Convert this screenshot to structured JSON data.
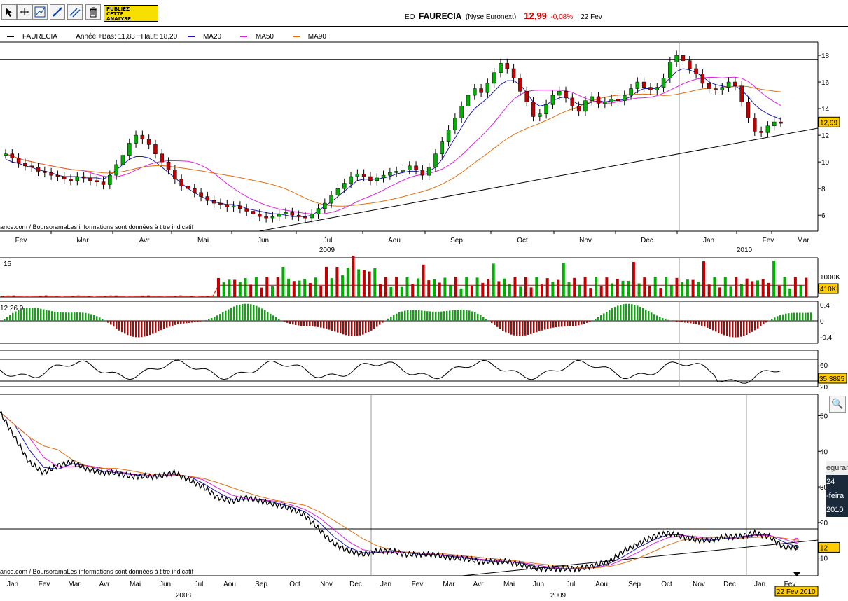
{
  "toolbar": {
    "ad_line1": "PUBLIEZ",
    "ad_line2": "CETTE",
    "ad_line3": "ANALYSE",
    "icons": [
      "cursor-icon",
      "crosshair-icon",
      "indicator-icon",
      "trendline-icon",
      "channel-icon",
      "trash-icon"
    ]
  },
  "header": {
    "code": "EO",
    "name": "FAURECIA",
    "market": "(Nyse Euronext)",
    "price": "12,99",
    "change": "-0,08%",
    "date": "22 Fev"
  },
  "legend": {
    "series": "FAURECIA",
    "range": "Année +Bas: 11,83 +Haut: 18,20",
    "ma20": "MA20",
    "ma50": "MA50",
    "ma90": "MA90"
  },
  "colors": {
    "up": "#00b000",
    "down": "#c00000",
    "ma20": "#1a1ab0",
    "ma50": "#e020e0",
    "ma90": "#e07010"
  },
  "copyright": "ance.com / BoursoramaLes informations sont données à titre indicatif",
  "chart_data": [
    {
      "type": "candlestick",
      "panel": "price-1y",
      "xlabels": [
        "Fev",
        "Mar",
        "Avr",
        "Mai",
        "Jun",
        "Jul",
        "Aou",
        "Sep",
        "Oct",
        "Nov",
        "Dec",
        "Jan",
        "Fev",
        "Mar"
      ],
      "years": [
        "2009",
        "2010"
      ],
      "yticks": [
        "18",
        "16",
        "14",
        "12",
        "10",
        "8",
        "6"
      ],
      "ylim": [
        4.8,
        19
      ],
      "price_label": "12,99",
      "close": [
        10.6,
        10.3,
        9.9,
        9.7,
        9.6,
        9.3,
        9.2,
        9.0,
        8.9,
        8.7,
        8.6,
        8.9,
        8.8,
        8.6,
        8.5,
        8.3,
        9.0,
        9.8,
        10.5,
        11.4,
        12.0,
        11.7,
        11.3,
        10.6,
        10.0,
        9.4,
        8.7,
        8.2,
        8.0,
        7.7,
        7.4,
        7.1,
        6.9,
        6.8,
        6.6,
        6.7,
        6.5,
        6.3,
        6.1,
        5.9,
        5.8,
        5.9,
        6.1,
        6.2,
        6.0,
        5.9,
        5.8,
        6.1,
        6.5,
        6.9,
        7.5,
        8.0,
        8.4,
        8.9,
        9.1,
        8.9,
        8.6,
        8.8,
        9.0,
        9.2,
        9.3,
        9.4,
        9.7,
        9.4,
        9.0,
        9.6,
        10.6,
        11.5,
        12.4,
        13.3,
        14.2,
        15.0,
        15.5,
        15.2,
        15.9,
        16.7,
        17.4,
        17.0,
        16.3,
        15.3,
        14.5,
        13.4,
        13.6,
        14.3,
        15.0,
        15.3,
        14.8,
        14.2,
        13.8,
        14.6,
        14.9,
        14.4,
        14.5,
        14.7,
        14.6,
        15.0,
        15.5,
        16.0,
        15.6,
        15.4,
        15.6,
        16.3,
        17.5,
        18.0,
        17.6,
        17.0,
        16.6,
        15.9,
        15.5,
        15.4,
        15.6,
        16.0,
        15.7,
        14.5,
        13.3,
        12.3,
        12.2,
        12.7,
        13.0,
        12.99
      ],
      "ma20": [
        10.2,
        10.0,
        9.9,
        9.7,
        9.6,
        9.4,
        9.3,
        9.2,
        9.0,
        8.9,
        8.9,
        8.9,
        8.8,
        8.8,
        8.8,
        8.7,
        9.0,
        9.4,
        9.8,
        10.2,
        10.4,
        10.4,
        10.3,
        10.0,
        9.6,
        9.2,
        8.8,
        8.4,
        8.0,
        7.7,
        7.4,
        7.2,
        7.0,
        6.9,
        6.8,
        6.8,
        6.7,
        6.5,
        6.4,
        6.3,
        6.2,
        6.1,
        6.1,
        6.0,
        5.9,
        5.9,
        5.9,
        6.0,
        6.3,
        6.7,
        7.0,
        7.4,
        7.8,
        8.2,
        8.6,
        8.7,
        8.7,
        8.7,
        8.8,
        8.9,
        9.1,
        9.2,
        9.3,
        9.3,
        9.2,
        9.3,
        9.6,
        10.2,
        11.0,
        11.8,
        12.6,
        13.4,
        14.0,
        14.4,
        14.8,
        15.3,
        15.8,
        16.1,
        16.1,
        15.8,
        15.2,
        14.5,
        14.2,
        14.3,
        14.6,
        14.8,
        14.9,
        14.6,
        14.3,
        14.3,
        14.5,
        14.6,
        14.5,
        14.6,
        14.6,
        14.7,
        14.9,
        15.3,
        15.5,
        15.5,
        15.5,
        15.8,
        16.3,
        16.8,
        17.0,
        16.9,
        16.7,
        16.4,
        16.0,
        15.8,
        15.7,
        15.6,
        15.7,
        15.4,
        14.9,
        14.3,
        13.9,
        13.6,
        13.4,
        13.2
      ]
    },
    {
      "type": "bar",
      "panel": "volume",
      "label": "15",
      "yticks": [
        "1000K"
      ],
      "value_label": "410K"
    },
    {
      "type": "bar",
      "panel": "macd",
      "label": "12 26 9",
      "yticks": [
        "0,4",
        "0",
        "-0,4"
      ]
    },
    {
      "type": "line",
      "panel": "rsi",
      "yticks": [
        "60",
        "20"
      ],
      "value_label": "35,3895"
    },
    {
      "type": "line",
      "panel": "price-3y",
      "xlabels": [
        "Jan",
        "Fev",
        "Mar",
        "Avr",
        "Mai",
        "Jun",
        "Jul",
        "Aou",
        "Sep",
        "Oct",
        "Nov",
        "Dec",
        "Jan",
        "Fev",
        "Mar",
        "Avr",
        "Mai",
        "Jun",
        "Jul",
        "Aou",
        "Sep",
        "Oct",
        "Nov",
        "Dec",
        "Jan",
        "Fev"
      ],
      "years": [
        "2008",
        "2009"
      ],
      "yticks": [
        "50",
        "40",
        "30",
        "20",
        "10"
      ],
      "ylim": [
        5,
        56
      ],
      "price_label": "12",
      "date_label": "22 Fev 2010",
      "values": [
        51,
        44,
        37,
        34,
        36,
        37,
        35,
        34,
        34,
        33,
        33,
        33,
        34,
        32,
        30,
        27,
        26,
        27,
        26,
        25,
        24,
        22,
        18,
        14,
        12,
        11,
        12,
        12,
        11,
        11,
        11,
        10,
        10,
        9,
        9,
        9,
        8,
        7,
        7,
        7,
        7,
        8,
        9,
        12,
        14,
        16,
        17,
        16,
        15,
        15,
        16,
        16,
        17,
        16,
        13,
        12.99
      ]
    }
  ]
}
